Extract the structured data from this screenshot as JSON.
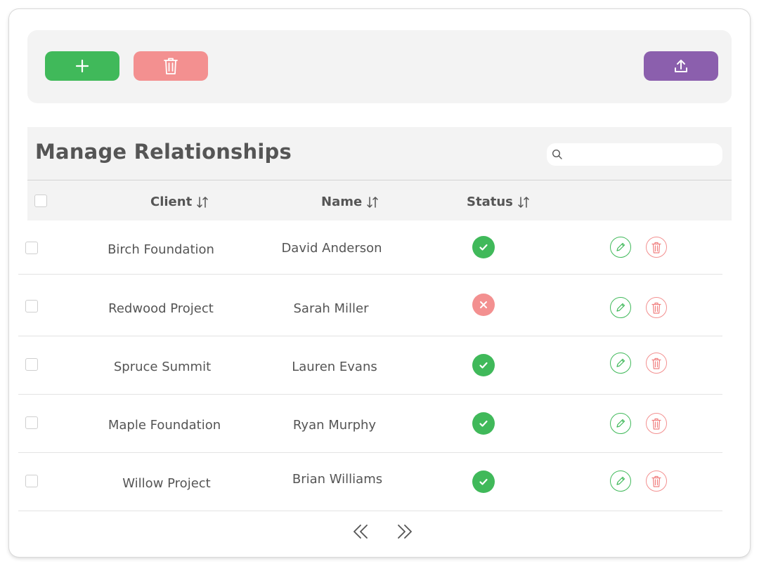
{
  "toolbar": {
    "add_icon": "plus-icon",
    "delete_icon": "trash-icon",
    "upload_icon": "upload-icon",
    "colors": {
      "add": "#40b95a",
      "delete": "#f39090",
      "upload": "#8b5fad"
    }
  },
  "table": {
    "title": "Manage Relationships",
    "search": {
      "value": "",
      "placeholder": ""
    },
    "columns": {
      "client": "Client",
      "name": "Name",
      "status": "Status"
    },
    "rows": [
      {
        "client": "Birch Foundation",
        "name": "David Anderson",
        "status": "active"
      },
      {
        "client": "Redwood Project",
        "name": "Sarah Miller",
        "status": "inactive"
      },
      {
        "client": "Spruce Summit",
        "name": "Lauren Evans",
        "status": "active"
      },
      {
        "client": "Maple Foundation",
        "name": "Ryan Murphy",
        "status": "active"
      },
      {
        "client": "Willow Project",
        "name": "Brian Williams",
        "status": "active"
      }
    ]
  },
  "pagination": {
    "prev_icon": "double-chevron-left-icon",
    "next_icon": "double-chevron-right-icon"
  }
}
